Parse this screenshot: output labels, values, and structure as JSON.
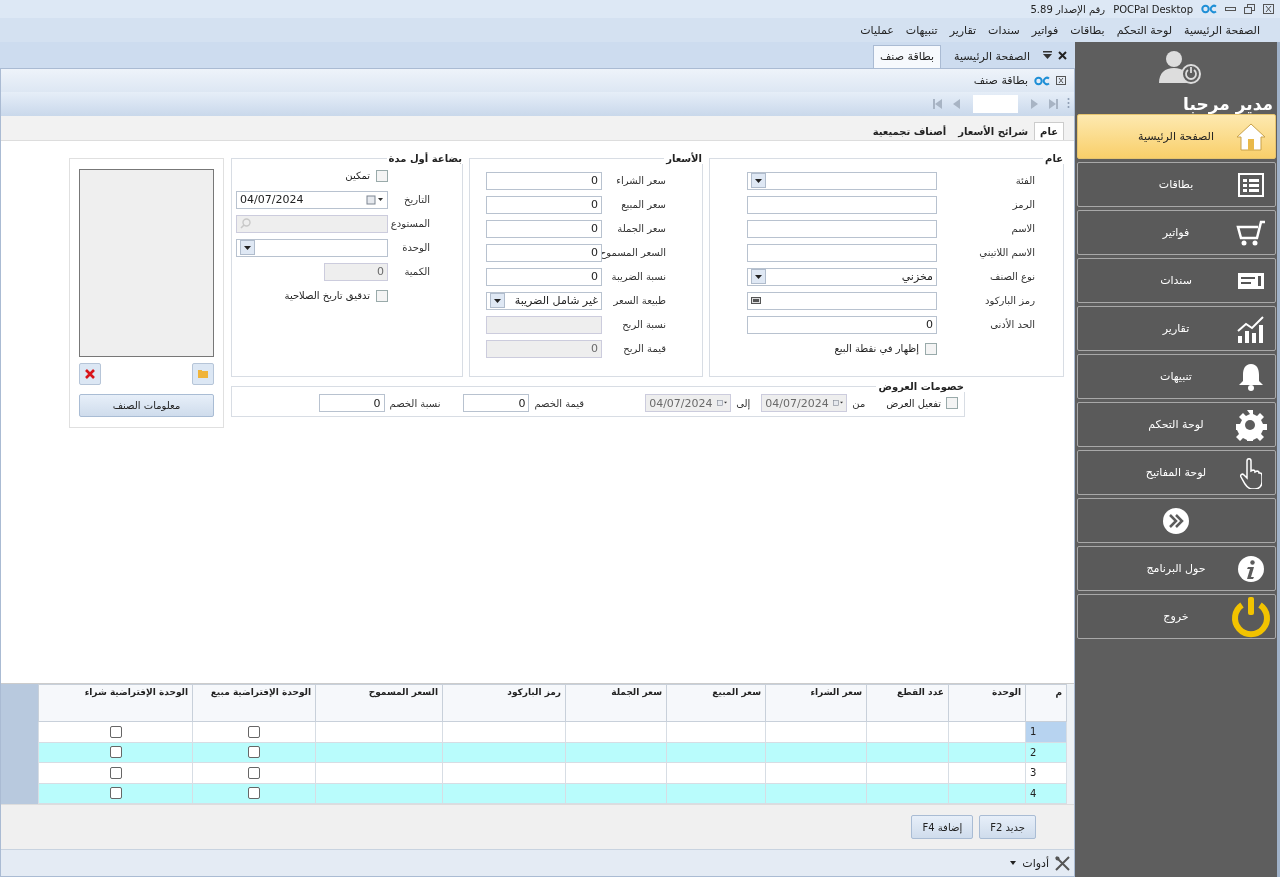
{
  "window": {
    "title": "POCPal Desktop",
    "version": "رقم الإصدار 5.89"
  },
  "menu": [
    "الصفحة الرئيسية",
    "لوحة التحكم",
    "بطاقات",
    "فواتير",
    "سندات",
    "تقارير",
    "تنبيهات",
    "عمليات"
  ],
  "doc_tabs": [
    {
      "label": "الصفحة الرئيسية",
      "selected": false
    },
    {
      "label": "بطاقة صنف",
      "selected": true
    }
  ],
  "document": {
    "title": "بطاقة صنف"
  },
  "section_tabs": [
    {
      "label": "عام",
      "selected": true
    },
    {
      "label": "شرائح الأسعار",
      "selected": false
    },
    {
      "label": "أصناف تجميعية",
      "selected": false
    }
  ],
  "general": {
    "title": "عام",
    "fields": [
      {
        "kind": "dropdown",
        "label": "الفئة",
        "disabled": false
      },
      {
        "kind": "text",
        "label": "الرمز",
        "disabled": false
      },
      {
        "kind": "text",
        "label": "الاسم",
        "disabled": false
      },
      {
        "kind": "text",
        "label": "الاسم اللاتيني",
        "disabled": false
      },
      {
        "kind": "dropdown",
        "label": "نوع الصنف",
        "value": "مخزني",
        "disabled": false
      },
      {
        "kind": "barcode",
        "label": "رمز الباركود",
        "disabled": false
      },
      {
        "kind": "text",
        "label": "الحد الأدنى",
        "value": "0",
        "disabled": false
      },
      {
        "kind": "checkbox",
        "label": "إظهار في نقطة البيع",
        "checked": false
      }
    ]
  },
  "prices": {
    "title": "الأسعار",
    "fields": [
      {
        "kind": "text",
        "label": "سعر الشراء",
        "value": "0",
        "disabled": false
      },
      {
        "kind": "text",
        "label": "سعر المبيع",
        "value": "0",
        "disabled": false
      },
      {
        "kind": "text",
        "label": "سعر الجملة",
        "value": "0",
        "disabled": false
      },
      {
        "kind": "text",
        "label": "السعر المسموح",
        "value": "0",
        "disabled": false
      },
      {
        "kind": "text",
        "label": "نسبة الضريبة",
        "value": "0",
        "disabled": false
      },
      {
        "kind": "dropdown",
        "label": "طبيعة السعر",
        "value": "غير شامل الضريبة",
        "disabled": false
      },
      {
        "kind": "text",
        "label": "نسبة الربح",
        "disabled": true
      },
      {
        "kind": "text",
        "label": "قيمة الربح",
        "value": "0",
        "disabled": true
      }
    ]
  },
  "opening_stock": {
    "title": "بضاعة أول مدة",
    "fields": [
      {
        "kind": "checkbox",
        "label": "تمكين",
        "checked": false
      },
      {
        "kind": "date",
        "label": "التاريخ",
        "value": "04/07/2024",
        "disabled": false
      },
      {
        "kind": "search",
        "label": "المستودع",
        "disabled": true
      },
      {
        "kind": "dropdown",
        "label": "الوحدة",
        "disabled": false
      },
      {
        "kind": "narrow",
        "label": "الكمية",
        "value": "0",
        "disabled": true
      },
      {
        "kind": "checkbox",
        "label": "تدقيق تاريخ الصلاحية",
        "checked": false
      }
    ]
  },
  "discounts": {
    "title": "خصومات العروض",
    "enable": {
      "label": "تفعيل العرض",
      "checked": false
    },
    "from_label": "من",
    "from": {
      "value": "04/07/2024",
      "disabled": true
    },
    "to_label": "إلى",
    "to": {
      "value": "04/07/2024",
      "disabled": true
    },
    "value_label": "قيمة الخصم",
    "value": "0",
    "rate_label": "نسبة الخصم",
    "rate": "0"
  },
  "image_panel": {
    "button": "معلومات الصنف"
  },
  "grid": {
    "columns": [
      "م",
      "الوحدة",
      "عدد القطع",
      "سعر الشراء",
      "سعر المبيع",
      "سعر الجملة",
      "رمز الباركود",
      "السعر المسموح",
      "الوحدة الإفتراضية مبيع",
      "الوحدة الإفتراضية شراء"
    ],
    "rows": [
      {
        "number": "1",
        "selected": true,
        "default_sale": false,
        "default_purchase": false
      },
      {
        "number": "2",
        "selected": false,
        "default_sale": false,
        "default_purchase": false
      },
      {
        "number": "3",
        "selected": false,
        "default_sale": false,
        "default_purchase": false
      },
      {
        "number": "4",
        "selected": false,
        "default_sale": false,
        "default_purchase": false
      }
    ]
  },
  "buttons": [
    "جديد F2",
    "إضافة F4"
  ],
  "tools": "أدوات",
  "sidebar": {
    "greeting": "مدير مرحبا",
    "items": [
      {
        "kind": "home",
        "label": "الصفحة الرئيسية",
        "selected": true
      },
      {
        "kind": "list",
        "label": "بطاقات",
        "selected": false
      },
      {
        "kind": "cart",
        "label": "فواتير",
        "selected": false
      },
      {
        "kind": "ticket",
        "label": "سندات",
        "selected": false
      },
      {
        "kind": "chart",
        "label": "تقارير",
        "selected": false
      },
      {
        "kind": "bell",
        "label": "تنبيهات",
        "selected": false
      },
      {
        "kind": "gear",
        "label": "لوحة التحكم",
        "selected": false
      },
      {
        "kind": "hand",
        "label": "لوحة المفاتيح",
        "selected": false
      },
      {
        "kind": "forward",
        "selected": false
      },
      {
        "kind": "info",
        "label": "حول البرنامج",
        "selected": false
      },
      {
        "kind": "power",
        "label": "خروج",
        "selected": false
      }
    ]
  }
}
